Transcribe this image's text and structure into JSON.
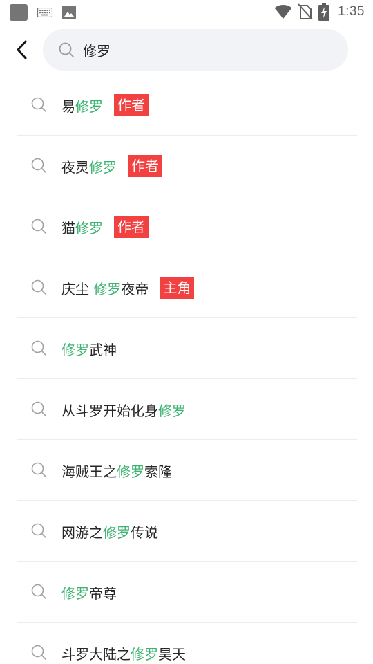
{
  "status_bar": {
    "time": "1:35",
    "icons": [
      "app-square-icon",
      "keyboard-icon",
      "image-icon",
      "wifi-icon",
      "no-sim-icon",
      "battery-charging-icon"
    ]
  },
  "search": {
    "query": "修罗",
    "placeholder": ""
  },
  "colors": {
    "highlight": "#3cb371",
    "tag_bg": "#f24141",
    "search_bg": "#f2f3f7"
  },
  "suggestions": [
    {
      "parts": [
        {
          "t": "易",
          "h": false
        },
        {
          "t": "修罗",
          "h": true
        }
      ],
      "tag": "作者"
    },
    {
      "parts": [
        {
          "t": "夜灵",
          "h": false
        },
        {
          "t": "修罗",
          "h": true
        }
      ],
      "tag": "作者"
    },
    {
      "parts": [
        {
          "t": "猫",
          "h": false
        },
        {
          "t": "修罗",
          "h": true
        }
      ],
      "tag": "作者"
    },
    {
      "parts": [
        {
          "t": "庆尘 ",
          "h": false
        },
        {
          "t": "修罗",
          "h": true
        },
        {
          "t": "夜帝",
          "h": false
        }
      ],
      "tag": "主角"
    },
    {
      "parts": [
        {
          "t": "修罗",
          "h": true
        },
        {
          "t": "武神",
          "h": false
        }
      ],
      "tag": ""
    },
    {
      "parts": [
        {
          "t": "从斗罗开始化身",
          "h": false
        },
        {
          "t": "修罗",
          "h": true
        }
      ],
      "tag": ""
    },
    {
      "parts": [
        {
          "t": "海贼王之",
          "h": false
        },
        {
          "t": "修罗",
          "h": true
        },
        {
          "t": "索隆",
          "h": false
        }
      ],
      "tag": ""
    },
    {
      "parts": [
        {
          "t": "网游之",
          "h": false
        },
        {
          "t": "修罗",
          "h": true
        },
        {
          "t": "传说",
          "h": false
        }
      ],
      "tag": ""
    },
    {
      "parts": [
        {
          "t": "修罗",
          "h": true
        },
        {
          "t": "帝尊",
          "h": false
        }
      ],
      "tag": ""
    },
    {
      "parts": [
        {
          "t": "斗罗大陆之",
          "h": false
        },
        {
          "t": "修罗",
          "h": true
        },
        {
          "t": "昊天",
          "h": false
        }
      ],
      "tag": ""
    }
  ]
}
